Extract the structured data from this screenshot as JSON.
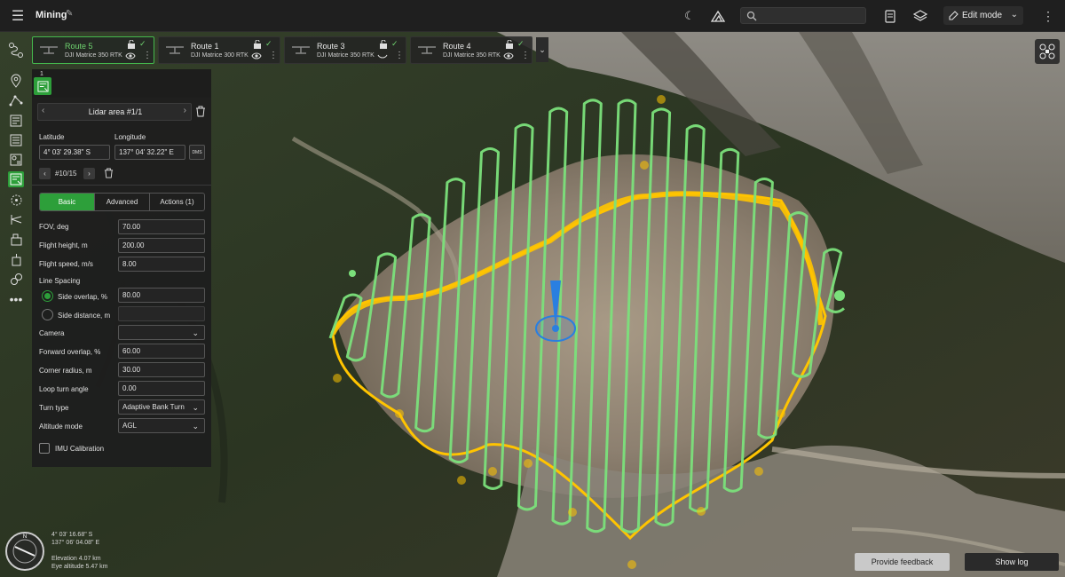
{
  "app": {
    "project_name": "Mining",
    "edit_mode_label": "Edit mode"
  },
  "search": {
    "value": "",
    "placeholder": ""
  },
  "routes": [
    {
      "name": "Route 5",
      "model": "DJI Matrice 350 RTK",
      "active": true
    },
    {
      "name": "Route 1",
      "model": "DJI Matrice 300 RTK",
      "active": false
    },
    {
      "name": "Route 3",
      "model": "DJI Matrice 350 RTK",
      "active": false
    },
    {
      "name": "Route 4",
      "model": "DJI Matrice 350 RTK",
      "active": false
    }
  ],
  "panel": {
    "tab_index": "1",
    "area_title": "Lidar area #1/1",
    "latitude_label": "Latitude",
    "longitude_label": "Longitude",
    "latitude_value": "4° 03' 29.38\" S",
    "longitude_value": "137° 04' 32.22\" E",
    "dms_label": "DMS",
    "waypoint_counter": "#10/15",
    "tabs": [
      "Basic",
      "Advanced",
      "Actions (1)"
    ],
    "fields": {
      "fov_label": "FOV, deg",
      "fov_value": "70.00",
      "flight_height_label": "Flight height, m",
      "flight_height_value": "200.00",
      "flight_speed_label": "Flight speed, m/s",
      "flight_speed_value": "8.00",
      "line_spacing_label": "Line Spacing",
      "side_overlap_label": "Side overlap, %",
      "side_overlap_value": "80.00",
      "side_distance_label": "Side distance, m",
      "side_distance_value": "",
      "camera_label": "Camera",
      "camera_value": "",
      "forward_overlap_label": "Forward overlap, %",
      "forward_overlap_value": "60.00",
      "corner_radius_label": "Corner radius, m",
      "corner_radius_value": "30.00",
      "loop_turn_label": "Loop turn angle",
      "loop_turn_value": "0.00",
      "turn_type_label": "Turn type",
      "turn_type_value": "Adaptive Bank Turn",
      "altitude_mode_label": "Altitude mode",
      "altitude_mode_value": "AGL",
      "imu_label": "IMU Calibration"
    }
  },
  "status": {
    "lat": "4° 03' 16.68\" S",
    "lon": "137° 06' 04.08\" E",
    "elevation": "Elevation 4.07 km",
    "eye_altitude": "Eye altitude 5.47 km",
    "compass_n": "N"
  },
  "buttons": {
    "feedback": "Provide feedback",
    "show_log": "Show log"
  },
  "colors": {
    "accent": "#2d9f3a",
    "route_green": "#7be07b",
    "boundary_yellow": "#ffc400"
  }
}
